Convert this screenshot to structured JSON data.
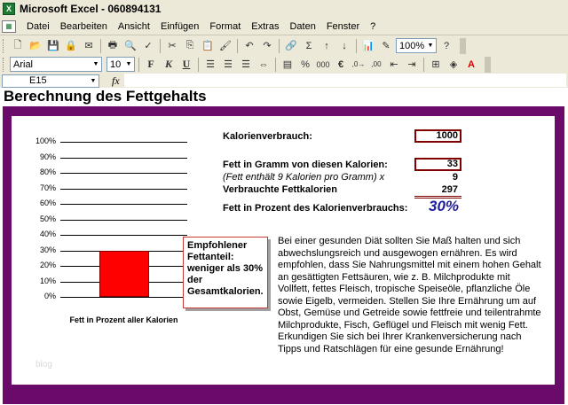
{
  "window": {
    "title": "Microsoft Excel - 060894131",
    "app_icon": "excel-icon"
  },
  "menu": {
    "doc_icon": "workbook-icon",
    "items": [
      "Datei",
      "Bearbeiten",
      "Ansicht",
      "Einfügen",
      "Format",
      "Extras",
      "Daten",
      "Fenster",
      "?"
    ]
  },
  "toolbar": {
    "zoom": "100%"
  },
  "format_toolbar": {
    "font": "Arial",
    "size": "10",
    "bold": "F",
    "italic": "K",
    "underline": "U",
    "currency": "€",
    "percent": "%",
    "thousands": "000"
  },
  "formula_bar": {
    "cell_ref": "E15",
    "fx": "fx",
    "formula": ""
  },
  "sheet": {
    "heading": "Berechnung des Fettgehalts",
    "labels": {
      "calories": "Kalorienverbrauch:",
      "fat_grams": "Fett in Gramm von diesen Kalorien:",
      "fat_note": "(Fett enthält 9 Kalorien pro Gramm) x",
      "fat_calories": "Verbrauchte Fettkalorien",
      "fat_percent": "Fett in Prozent des Kalorienverbrauchs:"
    },
    "values": {
      "calories": "1000",
      "fat_grams": "33",
      "factor": "9",
      "fat_calories": "297",
      "fat_percent": "30%"
    },
    "callout": "Empfohlener Fettanteil: weniger als 30% der Gesamtkalorien.",
    "paragraph": "Bei einer gesunden Diät sollten Sie Maß halten und sich abwechslungsreich und ausgewogen ernähren. Es wird empfohlen, dass Sie Nahrungsmittel mit einem hohen Gehalt an gesättigten Fettsäuren, wie z. B. Milchprodukte mit Vollfett, fettes Fleisch, tropische Speiseöle, pflanzliche Öle sowie Eigelb, vermeiden. Stellen Sie Ihre Ernährung um auf Obst, Gemüse und Getreide sowie fettfreie und teilentrahmte Milchprodukte, Fisch, Geflügel und Fleisch mit wenig Fett. Erkundigen Sie sich bei Ihrer Krankenversicherung nach Tipps und Ratschlägen für eine gesunde Ernährung!",
    "watermark": "blog"
  },
  "chart_data": {
    "type": "bar",
    "categories": [
      "Fett in Prozent aller Kalorien"
    ],
    "values": [
      30
    ],
    "title": "",
    "xlabel": "",
    "ylabel": "",
    "ylim": [
      0,
      100
    ],
    "yticks": [
      "0%",
      "10%",
      "20%",
      "30%",
      "40%",
      "50%",
      "60%",
      "70%",
      "80%",
      "90%",
      "100%"
    ],
    "grid": true,
    "bar_color": "#ff0000"
  },
  "colors": {
    "frame": "#6a0a6a",
    "accent": "#800000",
    "percent_text": "#1f1f9e"
  }
}
